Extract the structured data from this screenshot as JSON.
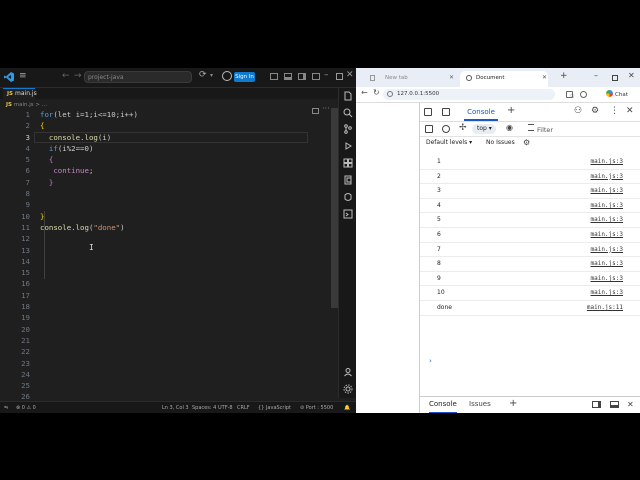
{
  "vscode": {
    "menu_glyph": "≡",
    "back_glyph": "←",
    "forward_glyph": "→",
    "search_placeholder": "project-java",
    "signin_label": "Sign In",
    "tab_badge": "JS",
    "tab_label": "main.js",
    "breadcrumb_badge": "JS",
    "breadcrumb_text": "main.js > ...",
    "active_line": 3,
    "line_numbers": [
      "1",
      "2",
      "3",
      "4",
      "5",
      "6",
      "7",
      "8",
      "9",
      "10",
      "11",
      "12",
      "13",
      "14",
      "15",
      "16",
      "17",
      "18",
      "19",
      "20",
      "21",
      "22",
      "23",
      "24",
      "25",
      "26"
    ],
    "code": {
      "l1_kw": "for",
      "l1_rest": "(let i=1;i<=10;i++)",
      "l2_brace": "{",
      "l3_fn": "console.log",
      "l3_rest": "(i)",
      "l4_kw": "if",
      "l4_rest": "(i%2==0)",
      "l5_brace": "{",
      "l6_kw": "continue",
      "l6_rest": ";",
      "l7_brace": "}",
      "l8": "",
      "l9": "",
      "l10_brace": "}",
      "l11_fn": "console.log",
      "l11_open": "(",
      "l11_str": "\"done\"",
      "l11_close": ")"
    },
    "status": {
      "problems": "⊗ 0 ⚠ 0",
      "position": "Ln 3, Col 3",
      "spaces": "Spaces: 4",
      "encoding": "UTF-8",
      "eol": "CRLF",
      "language": "{} JavaScript",
      "port": "⊘ Port : 5500"
    }
  },
  "browser": {
    "tabs": [
      {
        "label": "New tab"
      },
      {
        "label": "Document"
      }
    ],
    "url": "127.0.0.1:5500",
    "chat_label": "Chat",
    "devtools": {
      "console_tab": "Console",
      "context": "top ▾",
      "filter_placeholder": "Filter",
      "levels": "Default levels ▾",
      "issues": "No Issues",
      "logs": [
        {
          "value": "1",
          "source": "main.js:3"
        },
        {
          "value": "2",
          "source": "main.js:3"
        },
        {
          "value": "3",
          "source": "main.js:3"
        },
        {
          "value": "4",
          "source": "main.js:3"
        },
        {
          "value": "5",
          "source": "main.js:3"
        },
        {
          "value": "6",
          "source": "main.js:3"
        },
        {
          "value": "7",
          "source": "main.js:3"
        },
        {
          "value": "8",
          "source": "main.js:3"
        },
        {
          "value": "9",
          "source": "main.js:3"
        },
        {
          "value": "10",
          "source": "main.js:3"
        },
        {
          "value": "done",
          "source": "main.js:11"
        }
      ],
      "prompt": "›",
      "drawer": {
        "console": "Console",
        "issues": "Issues"
      }
    }
  },
  "colors": {
    "accent": "#0e7bd0",
    "devtools_accent": "#1a56c5",
    "editor_bg": "#1f1f1f"
  }
}
